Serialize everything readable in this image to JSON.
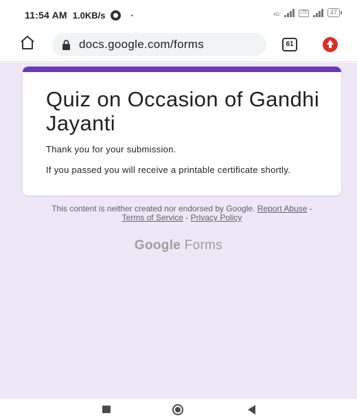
{
  "status_bar": {
    "time": "11:54 AM",
    "network_speed": "1.0KB/s",
    "dot": "·",
    "signal_label": "4G",
    "volte_label": "LTE",
    "battery": "47"
  },
  "browser": {
    "url": "docs.google.com/forms",
    "tab_count": "61"
  },
  "form": {
    "title": "Quiz on Occasion of Gandhi Jayanti",
    "confirmation": "Thank you for your submission.",
    "note": "If you passed you will receive a printable certificate shortly.",
    "accent_color": "#673ab7",
    "background_color": "#ede7f6"
  },
  "footer": {
    "disclaimer": "This content is neither created nor endorsed by Google.",
    "report_abuse": "Report Abuse",
    "sep1": "-",
    "terms": "Terms of Service",
    "sep2": "-",
    "privacy": "Privacy Policy"
  },
  "brand": {
    "google": "Google",
    "forms": "Forms"
  }
}
